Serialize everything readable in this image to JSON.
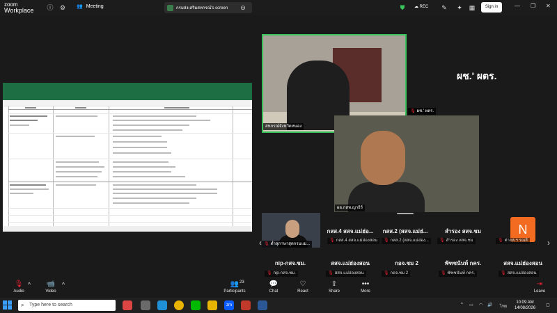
{
  "app": {
    "logo_line1": "zoom",
    "logo_line2": "Workplace",
    "meeting_label": "Meeting",
    "share_tab_title": "กรมส่งเสริมสหกรณ์'s screen",
    "rec_label": "REC",
    "signin_label": "Sign in"
  },
  "videos": {
    "main_label": "สหกรณ์จังหวัดหนอง",
    "second_label": "ผอ.กสท.ญาธิร์",
    "side_tag": "ผช.' ผตร.",
    "big_name": "ผช.' ผตร."
  },
  "participants": {
    "thumb_label": "ต่ำสุภาษาสุดกรมแม่...",
    "row1": [
      {
        "name": "กสส.4 สสจ.แม่ฮ่อ...",
        "sub": "กสส.4 สสจ.แม่ฮ่องสอน"
      },
      {
        "name": "กสส.2 (สสจ.แม่ฮ่...",
        "sub": "กสส.2 (สสจ.แม่ฮ่อง..."
      },
      {
        "name": "สำรอง สสจ.ชม",
        "sub": "สำรอง สสจ.ชม"
      },
      {
        "name": "N",
        "sub": "ต่างห.ฯ รณสิ"
      }
    ],
    "row2": [
      {
        "name": "nip-กสจ.ชม.",
        "sub": "nip-กสจ.ชม."
      },
      {
        "name": "สสจ.แม่ฮ่องสอน",
        "sub": "สสจ.แม่ฮ่องสอน"
      },
      {
        "name": "กอจ.ชม 2",
        "sub": "กอจ.ชม 2"
      },
      {
        "name": "พัฑชนันท์ กคร.",
        "sub": "พัฑชนันท์ กคร."
      },
      {
        "name": "สสจ.แม่ฮ่องสอน",
        "sub": "สสจ.แม่ฮ่องสอน"
      }
    ]
  },
  "toolbar": {
    "audio": "Audio",
    "video": "Video",
    "participants": "Participants",
    "participants_count": "23",
    "chat": "Chat",
    "react": "React",
    "share": "Share",
    "more": "More",
    "leave": "Leave"
  },
  "taskbar": {
    "search_placeholder": "Type here to search",
    "lang": "ไทย",
    "time": "10:09 AM",
    "date": "14/08/2026"
  },
  "colors": {
    "active_speaker": "#3bc35b",
    "avatar_n": "#f26b21",
    "excel_green": "#1e6e43"
  }
}
